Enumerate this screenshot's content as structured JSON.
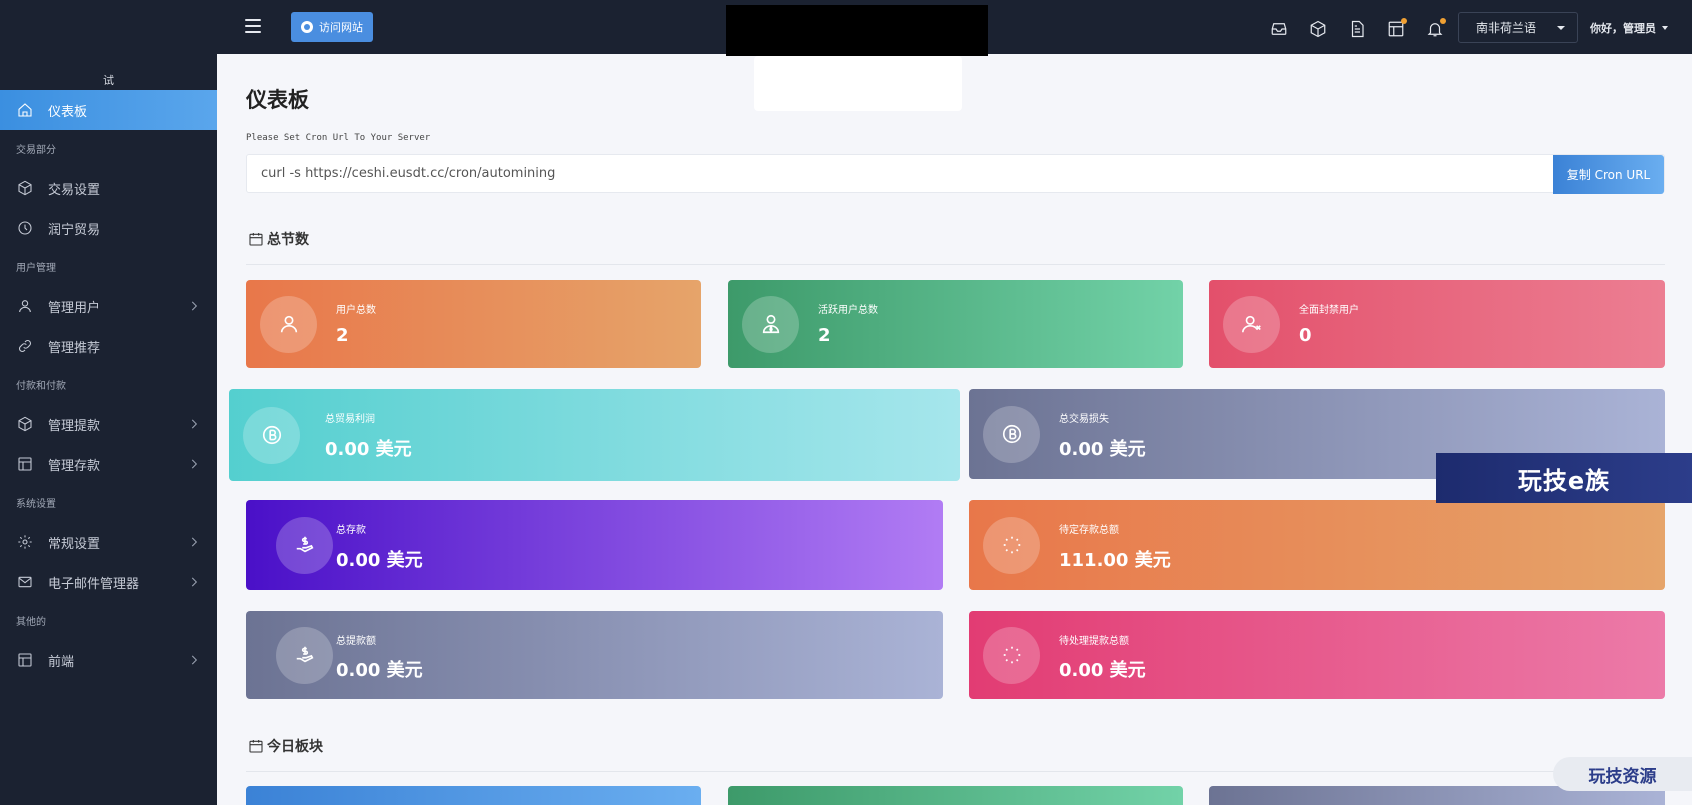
{
  "sidebar": {
    "brand": "试",
    "items": [
      {
        "type": "item",
        "label": "仪表板",
        "icon": "home-icon",
        "active": true
      },
      {
        "type": "section",
        "label": "交易部分"
      },
      {
        "type": "item",
        "label": "交易设置",
        "icon": "cube-icon"
      },
      {
        "type": "item",
        "label": "润宁贸易",
        "icon": "clock-icon"
      },
      {
        "type": "section",
        "label": "用户管理"
      },
      {
        "type": "item",
        "label": "管理用户",
        "icon": "user-icon",
        "chevron": true
      },
      {
        "type": "item",
        "label": "管理推荐",
        "icon": "link-icon"
      },
      {
        "type": "section",
        "label": "付款和付款"
      },
      {
        "type": "item",
        "label": "管理提款",
        "icon": "cube-icon",
        "chevron": true
      },
      {
        "type": "item",
        "label": "管理存款",
        "icon": "table-icon",
        "chevron": true
      },
      {
        "type": "section",
        "label": "系统设置"
      },
      {
        "type": "item",
        "label": "常规设置",
        "icon": "gear-icon",
        "chevron": true
      },
      {
        "type": "item",
        "label": "电子邮件管理器",
        "icon": "mail-icon",
        "chevron": true
      },
      {
        "type": "section",
        "label": "其他的"
      },
      {
        "type": "item",
        "label": "前端",
        "icon": "table-icon",
        "chevron": true
      }
    ]
  },
  "header": {
    "visit_label": "访问网站",
    "language": "南非荷兰语",
    "greeting": "你好，管理员",
    "icons": [
      "inbox-icon",
      "cube-icon",
      "document-icon",
      "table-icon",
      "bell-icon"
    ]
  },
  "main": {
    "title": "仪表板",
    "cron_label": "Please Set Cron Url To Your Server",
    "cron_value": "curl -s https://ceshi.eusdt.cc/cron/automining",
    "copy_label": "复制 Cron URL",
    "section_total": "总节数",
    "section_today": "今日板块",
    "cards": [
      {
        "label": "用户总数",
        "value": "2",
        "icon": "user-icon",
        "gradient": [
          "#e8774a",
          "#e6a46a"
        ]
      },
      {
        "label": "活跃用户总数",
        "value": "2",
        "icon": "user-tie-icon",
        "gradient": [
          "#3d9a6a",
          "#72d2a8"
        ]
      },
      {
        "label": "全面封禁用户",
        "value": "0",
        "icon": "user-x-icon",
        "gradient": [
          "#e3506b",
          "#ec7e92"
        ]
      },
      {
        "label": "总贸易利润",
        "value": "0.00 美元",
        "icon": "bitcoin-icon",
        "gradient": [
          "#54cfcf",
          "#a6e6ec"
        ]
      },
      {
        "label": "总交易损失",
        "value": "0.00 美元",
        "icon": "bitcoin-icon",
        "gradient": [
          "#6c7393",
          "#aab3d6"
        ]
      },
      {
        "label": "总存款",
        "value": "0.00 美元",
        "icon": "hand-dollar-icon",
        "gradient": [
          "#4a10c8",
          "#b17cf4"
        ]
      },
      {
        "label": "待定存款总额",
        "value": "111.00 美元",
        "icon": "spinner-icon",
        "gradient": [
          "#e8774a",
          "#e6a46a"
        ]
      },
      {
        "label": "总提款额",
        "value": "0.00 美元",
        "icon": "hand-dollar-icon",
        "gradient": [
          "#6c7393",
          "#aab3d6"
        ]
      },
      {
        "label": "待处理提款总额",
        "value": "0.00 美元",
        "icon": "spinner-icon",
        "gradient": [
          "#e23c73",
          "#ec7aa8"
        ]
      }
    ]
  },
  "watermarks": [
    "玩技e族",
    "玩技资源"
  ]
}
